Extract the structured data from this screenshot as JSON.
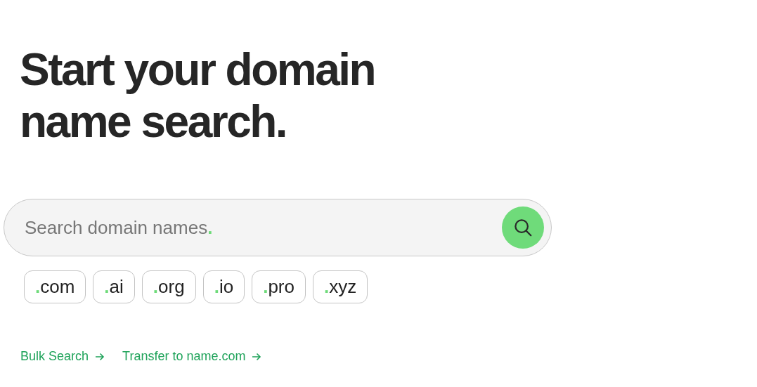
{
  "heading": {
    "lines": [
      "Start your domain",
      "name search."
    ]
  },
  "search": {
    "placeholder": "Search domain names",
    "placeholder_dot": "."
  },
  "tlds": [
    {
      "dot": ".",
      "name": "com"
    },
    {
      "dot": ".",
      "name": "ai"
    },
    {
      "dot": ".",
      "name": "org"
    },
    {
      "dot": ".",
      "name": "io"
    },
    {
      "dot": ".",
      "name": "pro"
    },
    {
      "dot": ".",
      "name": "xyz"
    }
  ],
  "links": [
    {
      "label": "Bulk Search"
    },
    {
      "label": "Transfer to name.com"
    }
  ]
}
